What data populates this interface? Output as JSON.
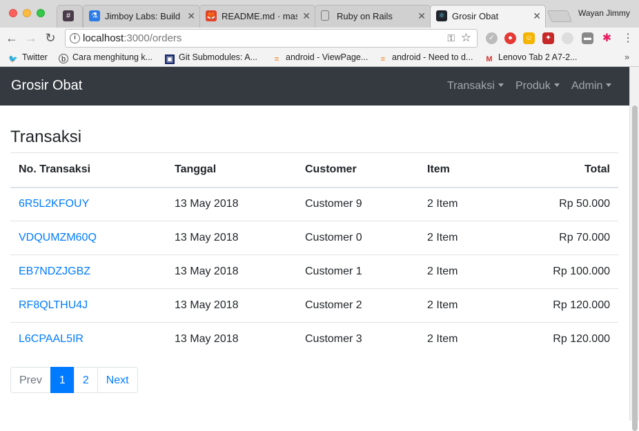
{
  "browser": {
    "tabs": [
      {
        "label": "",
        "icon": "slack-icon"
      },
      {
        "label": "Jimboy Labs: Build S",
        "icon": "flask-icon"
      },
      {
        "label": "README.md · maste",
        "icon": "gitlab-icon"
      },
      {
        "label": "Ruby on Rails",
        "icon": "document-icon"
      },
      {
        "label": "Grosir Obat",
        "icon": "react-icon"
      }
    ],
    "profile_name": "Wayan Jimmy",
    "url_host": "localhost",
    "url_rest": ":3000/orders",
    "bookmarks": [
      {
        "label": "Twitter",
        "icon": "twitter-icon"
      },
      {
        "label": "Cara menghitung k...",
        "icon": "bookmark-icon"
      },
      {
        "label": "Git Submodules: A...",
        "icon": "bookmark-icon"
      },
      {
        "label": "android - ViewPage...",
        "icon": "stackoverflow-icon"
      },
      {
        "label": "android - Need to d...",
        "icon": "stackoverflow-icon"
      },
      {
        "label": "Lenovo Tab 2 A7-2...",
        "icon": "bookmark-icon"
      }
    ]
  },
  "navbar": {
    "brand": "Grosir Obat",
    "items": [
      {
        "label": "Transaksi"
      },
      {
        "label": "Produk"
      },
      {
        "label": "Admin"
      }
    ]
  },
  "page": {
    "title": "Transaksi",
    "columns": [
      "No. Transaksi",
      "Tanggal",
      "Customer",
      "Item",
      "Total"
    ],
    "rows": [
      {
        "id": "6R5L2KFOUY",
        "date": "13 May 2018",
        "customer": "Customer 9",
        "items": "2 Item",
        "total": "Rp 50.000"
      },
      {
        "id": "VDQUMZM60Q",
        "date": "13 May 2018",
        "customer": "Customer 0",
        "items": "2 Item",
        "total": "Rp 70.000"
      },
      {
        "id": "EB7NDZJGBZ",
        "date": "13 May 2018",
        "customer": "Customer 1",
        "items": "2 Item",
        "total": "Rp 100.000"
      },
      {
        "id": "RF8QLTHU4J",
        "date": "13 May 2018",
        "customer": "Customer 2",
        "items": "2 Item",
        "total": "Rp 120.000"
      },
      {
        "id": "L6CPAAL5IR",
        "date": "13 May 2018",
        "customer": "Customer 3",
        "items": "2 Item",
        "total": "Rp 120.000"
      }
    ],
    "pagination": {
      "prev": "Prev",
      "pages": [
        "1",
        "2"
      ],
      "current": "1",
      "next": "Next"
    }
  },
  "colors": {
    "navbar_bg": "#343a40",
    "link": "#007bff",
    "active_page": "#007bff"
  }
}
